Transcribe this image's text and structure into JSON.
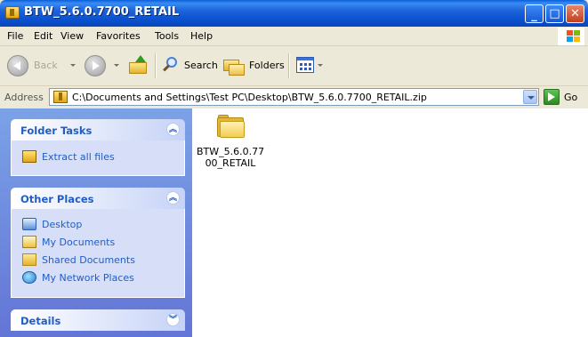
{
  "window": {
    "title": "BTW_5.6.0.7700_RETAIL",
    "minimize_glyph": "_",
    "maximize_glyph": "□",
    "close_glyph": "✕"
  },
  "menu": {
    "items": [
      "File",
      "Edit",
      "View",
      "Favorites",
      "Tools",
      "Help"
    ]
  },
  "toolbar": {
    "back_label": "Back",
    "search_label": "Search",
    "folders_label": "Folders"
  },
  "address": {
    "label": "Address",
    "value": "C:\\Documents and Settings\\Test PC\\Desktop\\BTW_5.6.0.7700_RETAIL.zip",
    "go_label": "Go"
  },
  "panels": {
    "folder_tasks": {
      "title": "Folder Tasks",
      "items": [
        {
          "label": "Extract all files",
          "icon": "zip-folder-icon"
        }
      ]
    },
    "other_places": {
      "title": "Other Places",
      "items": [
        {
          "label": "Desktop",
          "icon": "desktop-icon"
        },
        {
          "label": "My Documents",
          "icon": "my-documents-icon"
        },
        {
          "label": "Shared Documents",
          "icon": "shared-documents-icon"
        },
        {
          "label": "My Network Places",
          "icon": "network-places-icon"
        }
      ]
    },
    "details": {
      "title": "Details"
    }
  },
  "files": [
    {
      "name_line1": "BTW_5.6.0.77",
      "name_line2": "00_RETAIL",
      "icon": "folder-icon"
    }
  ],
  "colors": {
    "titlebar": "#0a50cf",
    "taskpane_top": "#7ba2e7",
    "taskpane_bottom": "#6375d6",
    "panel_title": "#215dc6",
    "panel_body": "#d6dff7",
    "chrome": "#ece9d8"
  }
}
